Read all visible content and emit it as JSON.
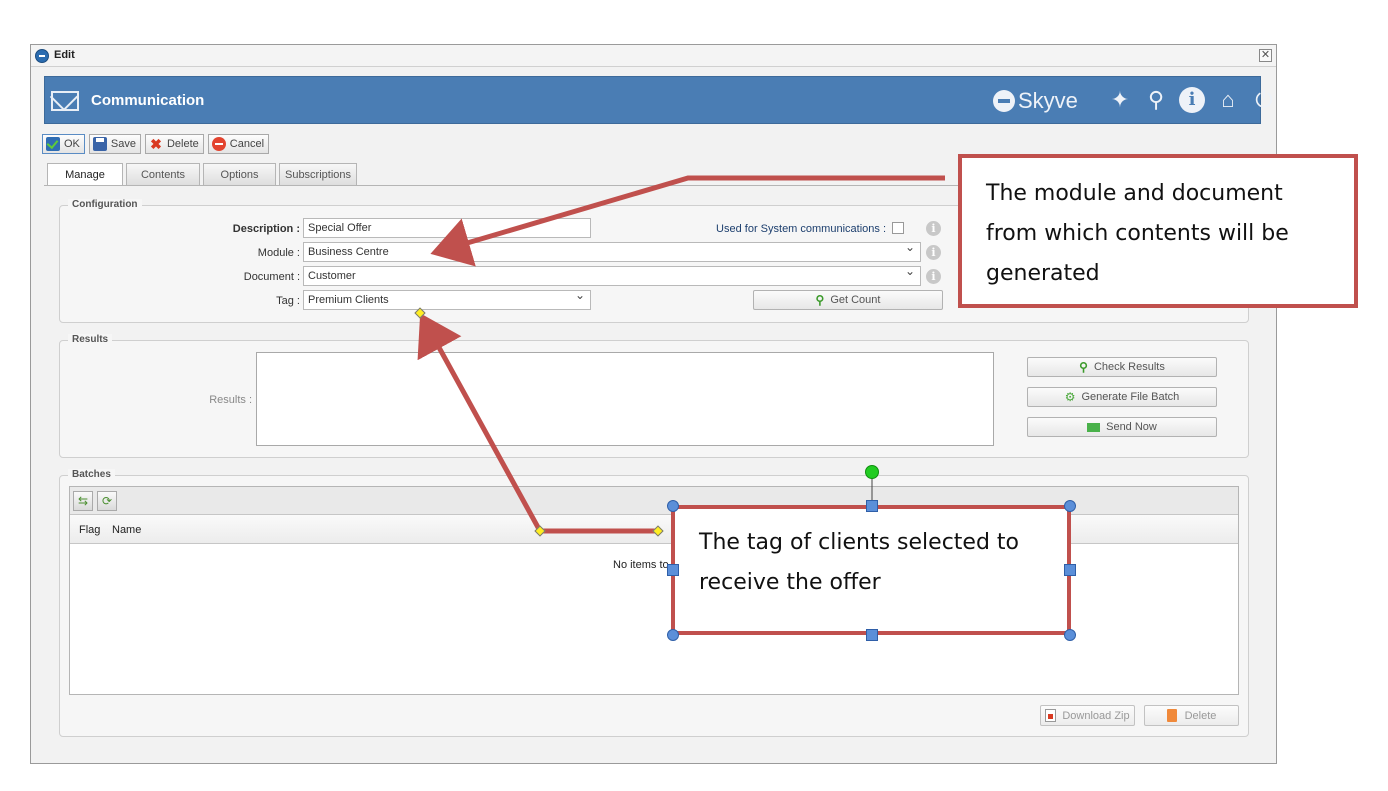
{
  "window": {
    "title": "Edit",
    "close_glyph": "✕"
  },
  "header": {
    "title": "Communication",
    "brand": "Skyve",
    "icons": [
      "pin-icon",
      "search-icon",
      "info-icon",
      "home-icon",
      "power-icon"
    ]
  },
  "toolbar": {
    "ok": "OK",
    "save": "Save",
    "delete": "Delete",
    "cancel": "Cancel"
  },
  "tabs": [
    "Manage",
    "Contents",
    "Options",
    "Subscriptions"
  ],
  "configuration": {
    "legend": "Configuration",
    "description_label": "Description :",
    "description_value": "Special Offer",
    "module_label": "Module :",
    "module_value": "Business Centre",
    "document_label": "Document :",
    "document_value": "Customer",
    "tag_label": "Tag :",
    "tag_value": "Premium Clients",
    "system_label": "Used for System communications :",
    "get_count": "Get Count"
  },
  "results": {
    "legend": "Results",
    "label": "Results :",
    "check_results": "Check Results",
    "generate_batch": "Generate File Batch",
    "send_now": "Send Now"
  },
  "batches": {
    "legend": "Batches",
    "columns": [
      "Flag",
      "Name"
    ],
    "empty_text": "No items to",
    "download_zip": "Download Zip",
    "delete": "Delete"
  },
  "annotations": {
    "callout1": "The module and document from which contents will be generated",
    "callout2": "The tag of clients selected to receive the offer"
  },
  "colors": {
    "header": "#4a7db4",
    "callout_border": "#c0504d",
    "accent_green": "#3b9a2a"
  }
}
